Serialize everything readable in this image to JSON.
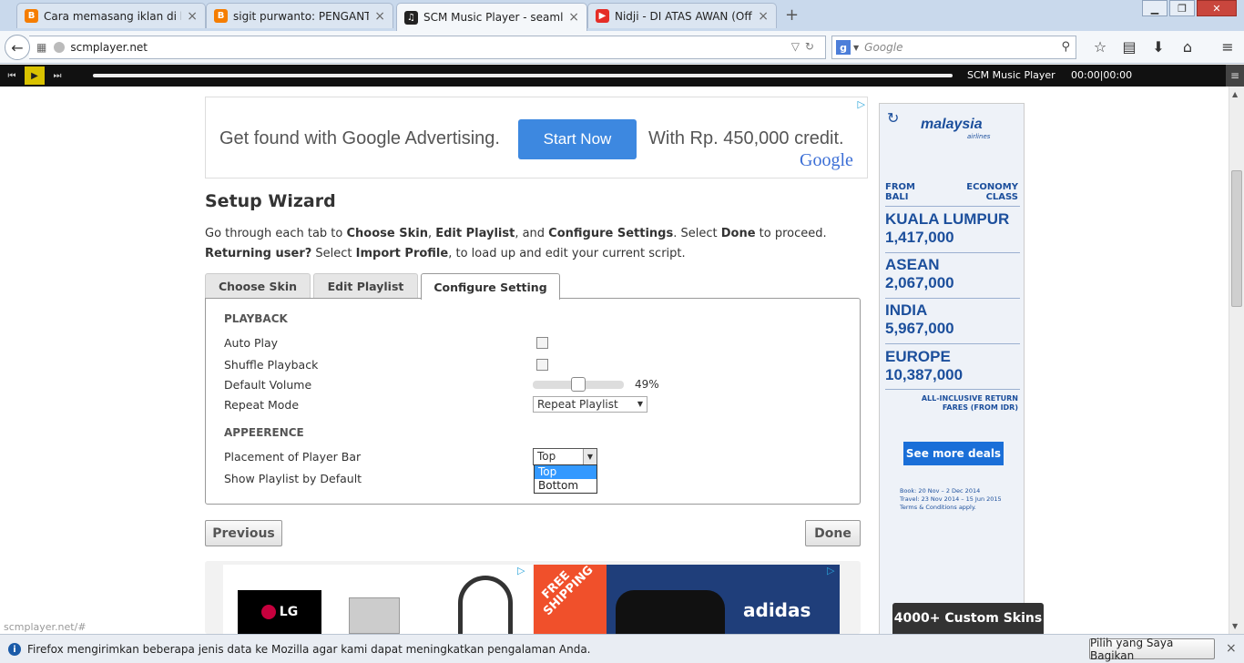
{
  "browser": {
    "tabs": [
      {
        "title": "Cara memasang iklan di bl...",
        "favicon_color": "#f57d00",
        "icon": "blogger-icon"
      },
      {
        "title": "sigit purwanto: PENGANT...",
        "favicon_color": "#f57d00",
        "icon": "blogger-icon"
      },
      {
        "title": "SCM Music Player - seamle...",
        "favicon_color": "#222222",
        "icon": "music-note-icon"
      },
      {
        "title": "Nidji - DI ATAS AWAN (Off...",
        "favicon_color": "#e52d27",
        "icon": "youtube-icon"
      }
    ],
    "url": "scmplayer.net",
    "search_placeholder": "Google",
    "search_engine_letter": "g"
  },
  "player": {
    "title": "SCM Music Player",
    "time": "00:00|00:00",
    "progress": 0
  },
  "top_ad": {
    "text_left": "Get found with Google Advertising.",
    "button": "Start Now",
    "text_right": "With Rp. 450,000 credit.",
    "logo": "Google"
  },
  "wizard": {
    "title": "Setup Wizard",
    "intro_1_a": "Go through each tab to ",
    "intro_1_b": "Choose Skin",
    "intro_1_c": ", ",
    "intro_1_d": "Edit Playlist",
    "intro_1_e": ", and ",
    "intro_1_f": "Configure Settings",
    "intro_1_g": ". Select ",
    "intro_1_h": "Done",
    "intro_1_i": " to proceed.",
    "intro_2_a": "Returning user?",
    "intro_2_b": " Select ",
    "intro_2_c": "Import Profile",
    "intro_2_d": ", to load up and edit your current script.",
    "tabs": [
      "Choose Skin",
      "Edit Playlist",
      "Configure Setting"
    ],
    "playback_heading": "PLAYBACK",
    "auto_play": "Auto Play",
    "shuffle": "Shuffle Playback",
    "default_volume": "Default Volume",
    "volume_value": "49%",
    "volume_fraction": 0.49,
    "repeat_mode": "Repeat Mode",
    "repeat_value": "Repeat Playlist",
    "appearance_heading": "APPEERENCE",
    "placement": "Placement of Player Bar",
    "placement_value": "Top",
    "placement_options": [
      "Top",
      "Bottom"
    ],
    "show_playlist": "Show Playlist by Default",
    "previous": "Previous",
    "done": "Done"
  },
  "bottom_ad": {
    "lg": "LG",
    "free": "FREE SHIPPING",
    "brand": "adidas"
  },
  "side_ad": {
    "brand": "malaysia",
    "brand_sub": "airlines",
    "from": "FROM",
    "from_city": "BALI",
    "class_1": "ECONOMY",
    "class_2": "CLASS",
    "destinations": [
      {
        "city": "KUALA LUMPUR",
        "price": "1,417,000"
      },
      {
        "city": "ASEAN",
        "price": "2,067,000"
      },
      {
        "city": "INDIA",
        "price": "5,967,000"
      },
      {
        "city": "EUROPE",
        "price": "10,387,000"
      }
    ],
    "inclusive_1": "ALL-INCLUSIVE RETURN",
    "inclusive_2": "FARES (FROM IDR)",
    "button": "See more deals",
    "fine_1": "Book: 20 Nov – 2 Dec 2014",
    "fine_2": "Travel: 23 Nov 2014 – 15 Jun 2015",
    "fine_3": "Terms & Conditions apply."
  },
  "skins_badge": "4000+ Custom Skins",
  "status_url": "scmplayer.net/#",
  "notification": {
    "message": "Firefox mengirimkan beberapa jenis data ke Mozilla agar kami dapat meningkatkan pengalaman Anda.",
    "button": "Pilih yang Saya Bagikan"
  }
}
